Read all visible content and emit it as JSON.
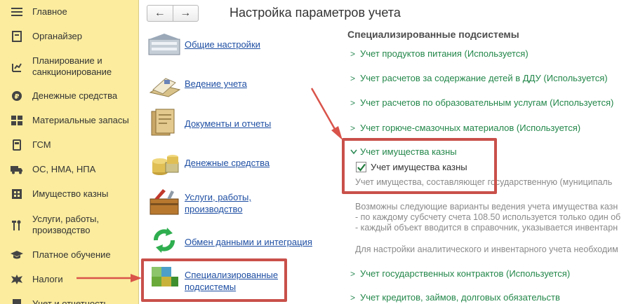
{
  "sidebar": {
    "items": [
      {
        "label": "Главное",
        "icon": "menu-icon"
      },
      {
        "label": "Органайзер",
        "icon": "notebook-icon"
      },
      {
        "label": "Планирование и санкционирование",
        "icon": "planning-icon"
      },
      {
        "label": "Денежные средства",
        "icon": "coin-icon"
      },
      {
        "label": "Материальные запасы",
        "icon": "grid-icon"
      },
      {
        "label": "ГСМ",
        "icon": "fuel-icon"
      },
      {
        "label": "ОС, НМА, НПА",
        "icon": "truck-icon"
      },
      {
        "label": "Имущество казны",
        "icon": "building-icon"
      },
      {
        "label": "Услуги, работы, производство",
        "icon": "tools-icon"
      },
      {
        "label": "Платное обучение",
        "icon": "graduation-icon"
      },
      {
        "label": "Налоги",
        "icon": "emblem-icon"
      },
      {
        "label": "Учет и отчетность",
        "icon": "report-icon"
      }
    ]
  },
  "nav": {
    "back": "←",
    "forward": "→"
  },
  "page_title": "Настройка параметров учета",
  "sections": [
    {
      "label": "Общие настройки",
      "icon": "building-settings-icon"
    },
    {
      "label": "Ведение учета",
      "icon": "ledger-icon"
    },
    {
      "label": "Документы и отчеты",
      "icon": "documents-icon"
    },
    {
      "label": "Денежные средства",
      "icon": "coins-icon"
    },
    {
      "label": "Услуги, работы, производство",
      "icon": "toolbox-icon"
    },
    {
      "label": "Обмен данными и интеграция",
      "icon": "sync-icon"
    },
    {
      "label": "Специализированные подсистемы",
      "icon": "cubes-icon"
    }
  ],
  "panel": {
    "title": "Специализированные подсистемы",
    "groups": [
      "Учет продуктов питания (Используется)",
      "Учет расчетов за содержание детей в ДДУ (Используется)",
      "Учет расчетов по образовательным услугам (Используется)",
      "Учет горюче-смазочных материалов (Используется)",
      "Учет имущества казны",
      "Учет государственных контрактов (Используется)",
      "Учет кредитов, займов, долговых обязательств"
    ],
    "checkbox_label": "Учет имущества казны",
    "checkbox_checked": true,
    "desc_1": "Учет имущества, составляющег государственную (муниципаль",
    "desc_2": "Возможны следующие варианты ведения учета имущества казн",
    "desc_3": "- по каждому субсчету счета 108.50 используется только один об",
    "desc_4": "- каждый объект вводится в справочник, указывается инвентарн",
    "desc_5": "Для настройки аналитического и инвентарного учета необходим"
  },
  "colors": {
    "sidebar": "#fbec9e",
    "link": "#1f4fa3",
    "green": "#23874a",
    "highlight": "#c9504a"
  }
}
